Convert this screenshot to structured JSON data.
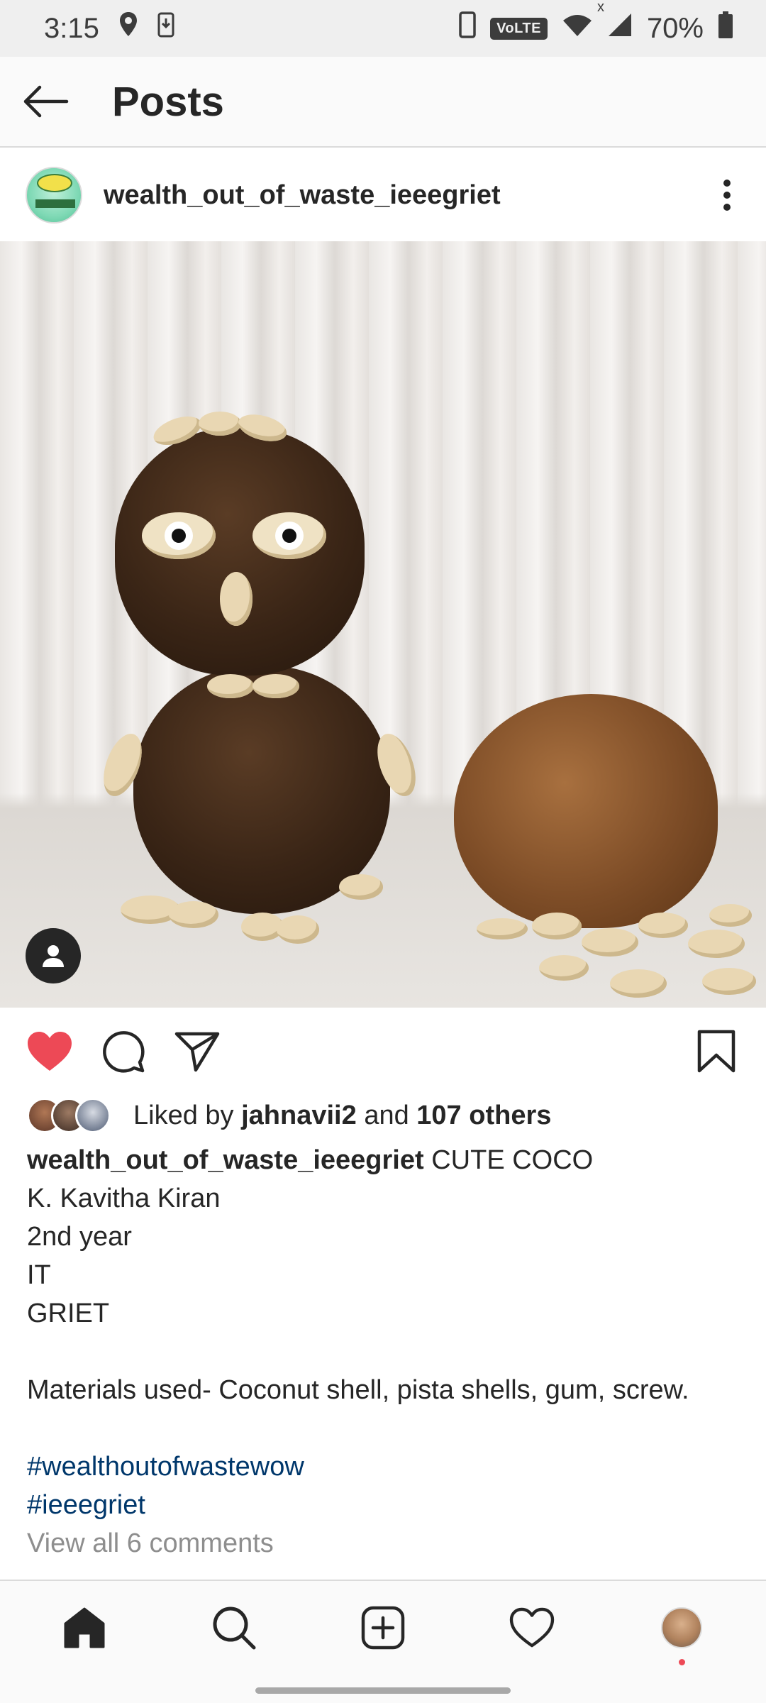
{
  "status_bar": {
    "time": "3:15",
    "network_badge": "VoLTE",
    "signal_marker": "x",
    "battery": "70%",
    "icons": [
      "location-icon",
      "download-icon",
      "phone-vibrate-icon",
      "wifi-icon",
      "signal-icon",
      "battery-icon"
    ]
  },
  "header": {
    "title": "Posts",
    "back_icon": "arrow-left-icon"
  },
  "post": {
    "username": "wealth_out_of_waste_ieeegriet",
    "avatar_icon": "wow-logo-avatar",
    "more_icon": "more-vertical-icon",
    "image_alt": "Coconut shell owl decorated with pistachio shells next to a half coconut",
    "actions": {
      "liked": true,
      "like_icon": "heart-filled-icon",
      "comment_icon": "comment-icon",
      "share_icon": "send-icon",
      "save_icon": "bookmark-icon"
    },
    "likes": {
      "prefix": "Liked by",
      "user": "jahnavii2",
      "joiner": "and",
      "others": "107 others"
    },
    "caption": {
      "username": "wealth_out_of_waste_ieeegriet",
      "title": "CUTE COCO",
      "lines": [
        "K. Kavitha Kiran",
        "2nd year",
        "IT",
        "GRIET",
        "",
        "Materials used- Coconut shell, pista shells, gum, screw.",
        ""
      ],
      "hashtags": [
        "#wealthoutofwastewow",
        "#ieeegriet"
      ],
      "view_comments": "View all 6 comments"
    }
  },
  "bottom_nav": {
    "items": [
      {
        "name": "home",
        "icon": "home-icon",
        "active": true
      },
      {
        "name": "search",
        "icon": "search-icon",
        "active": false
      },
      {
        "name": "new-post",
        "icon": "add-square-icon",
        "active": false
      },
      {
        "name": "activity",
        "icon": "heart-outline-icon",
        "active": false
      },
      {
        "name": "profile",
        "icon": "profile-avatar-icon",
        "active": false
      }
    ]
  },
  "colors": {
    "like_red": "#ed4956",
    "hashtag_blue": "#00376b",
    "text": "#262626",
    "muted": "#8e8e8e"
  }
}
